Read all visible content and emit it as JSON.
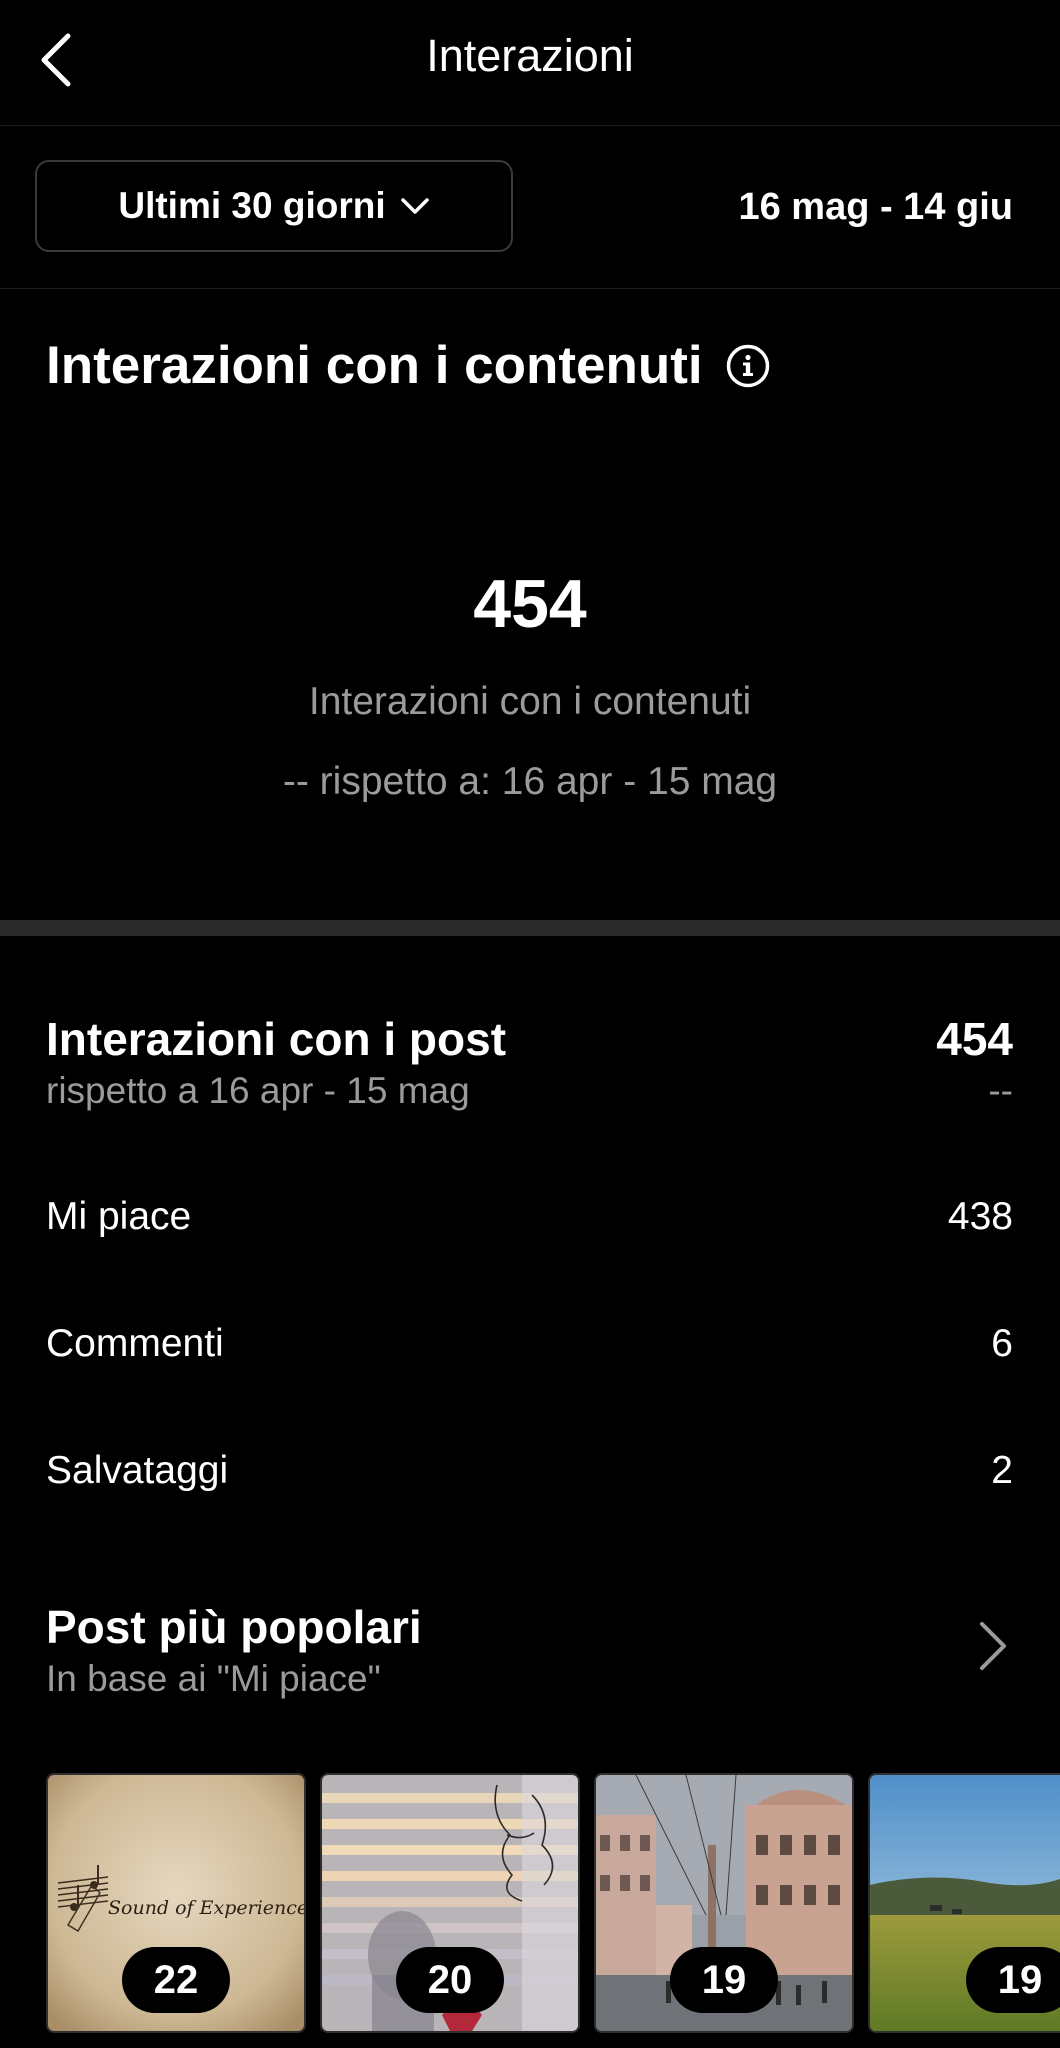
{
  "header": {
    "title": "Interazioni",
    "back_icon": "chevron-left-icon"
  },
  "filter": {
    "range_label": "Ultimi 30 giorni",
    "range_icon": "chevron-down-icon",
    "date_range": "16 mag - 14 giu"
  },
  "summary": {
    "title": "Interazioni con i contenuti",
    "info_icon": "info-icon",
    "total": "454",
    "caption": "Interazioni con i contenuti",
    "comparison": "-- rispetto a: 16 apr - 15 mag"
  },
  "post_interactions": {
    "title": "Interazioni con i post",
    "subtitle": "rispetto a 16 apr - 15 mag",
    "total": "454",
    "change": "--",
    "metrics": [
      {
        "label": "Mi piace",
        "value": "438"
      },
      {
        "label": "Commenti",
        "value": "6"
      },
      {
        "label": "Salvataggi",
        "value": "2"
      }
    ]
  },
  "popular_posts": {
    "title": "Post più popolari",
    "subtitle": "In base ai \"Mi piace\"",
    "chevron_icon": "chevron-right-icon",
    "posts": [
      {
        "count": "22",
        "caption_text": "Sound of Experience"
      },
      {
        "count": "20"
      },
      {
        "count": "19"
      },
      {
        "count": "19"
      }
    ]
  },
  "colors": {
    "background": "#000000",
    "text": "#ffffff",
    "muted": "#9b9b9b",
    "divider": "#2a2a2a"
  }
}
